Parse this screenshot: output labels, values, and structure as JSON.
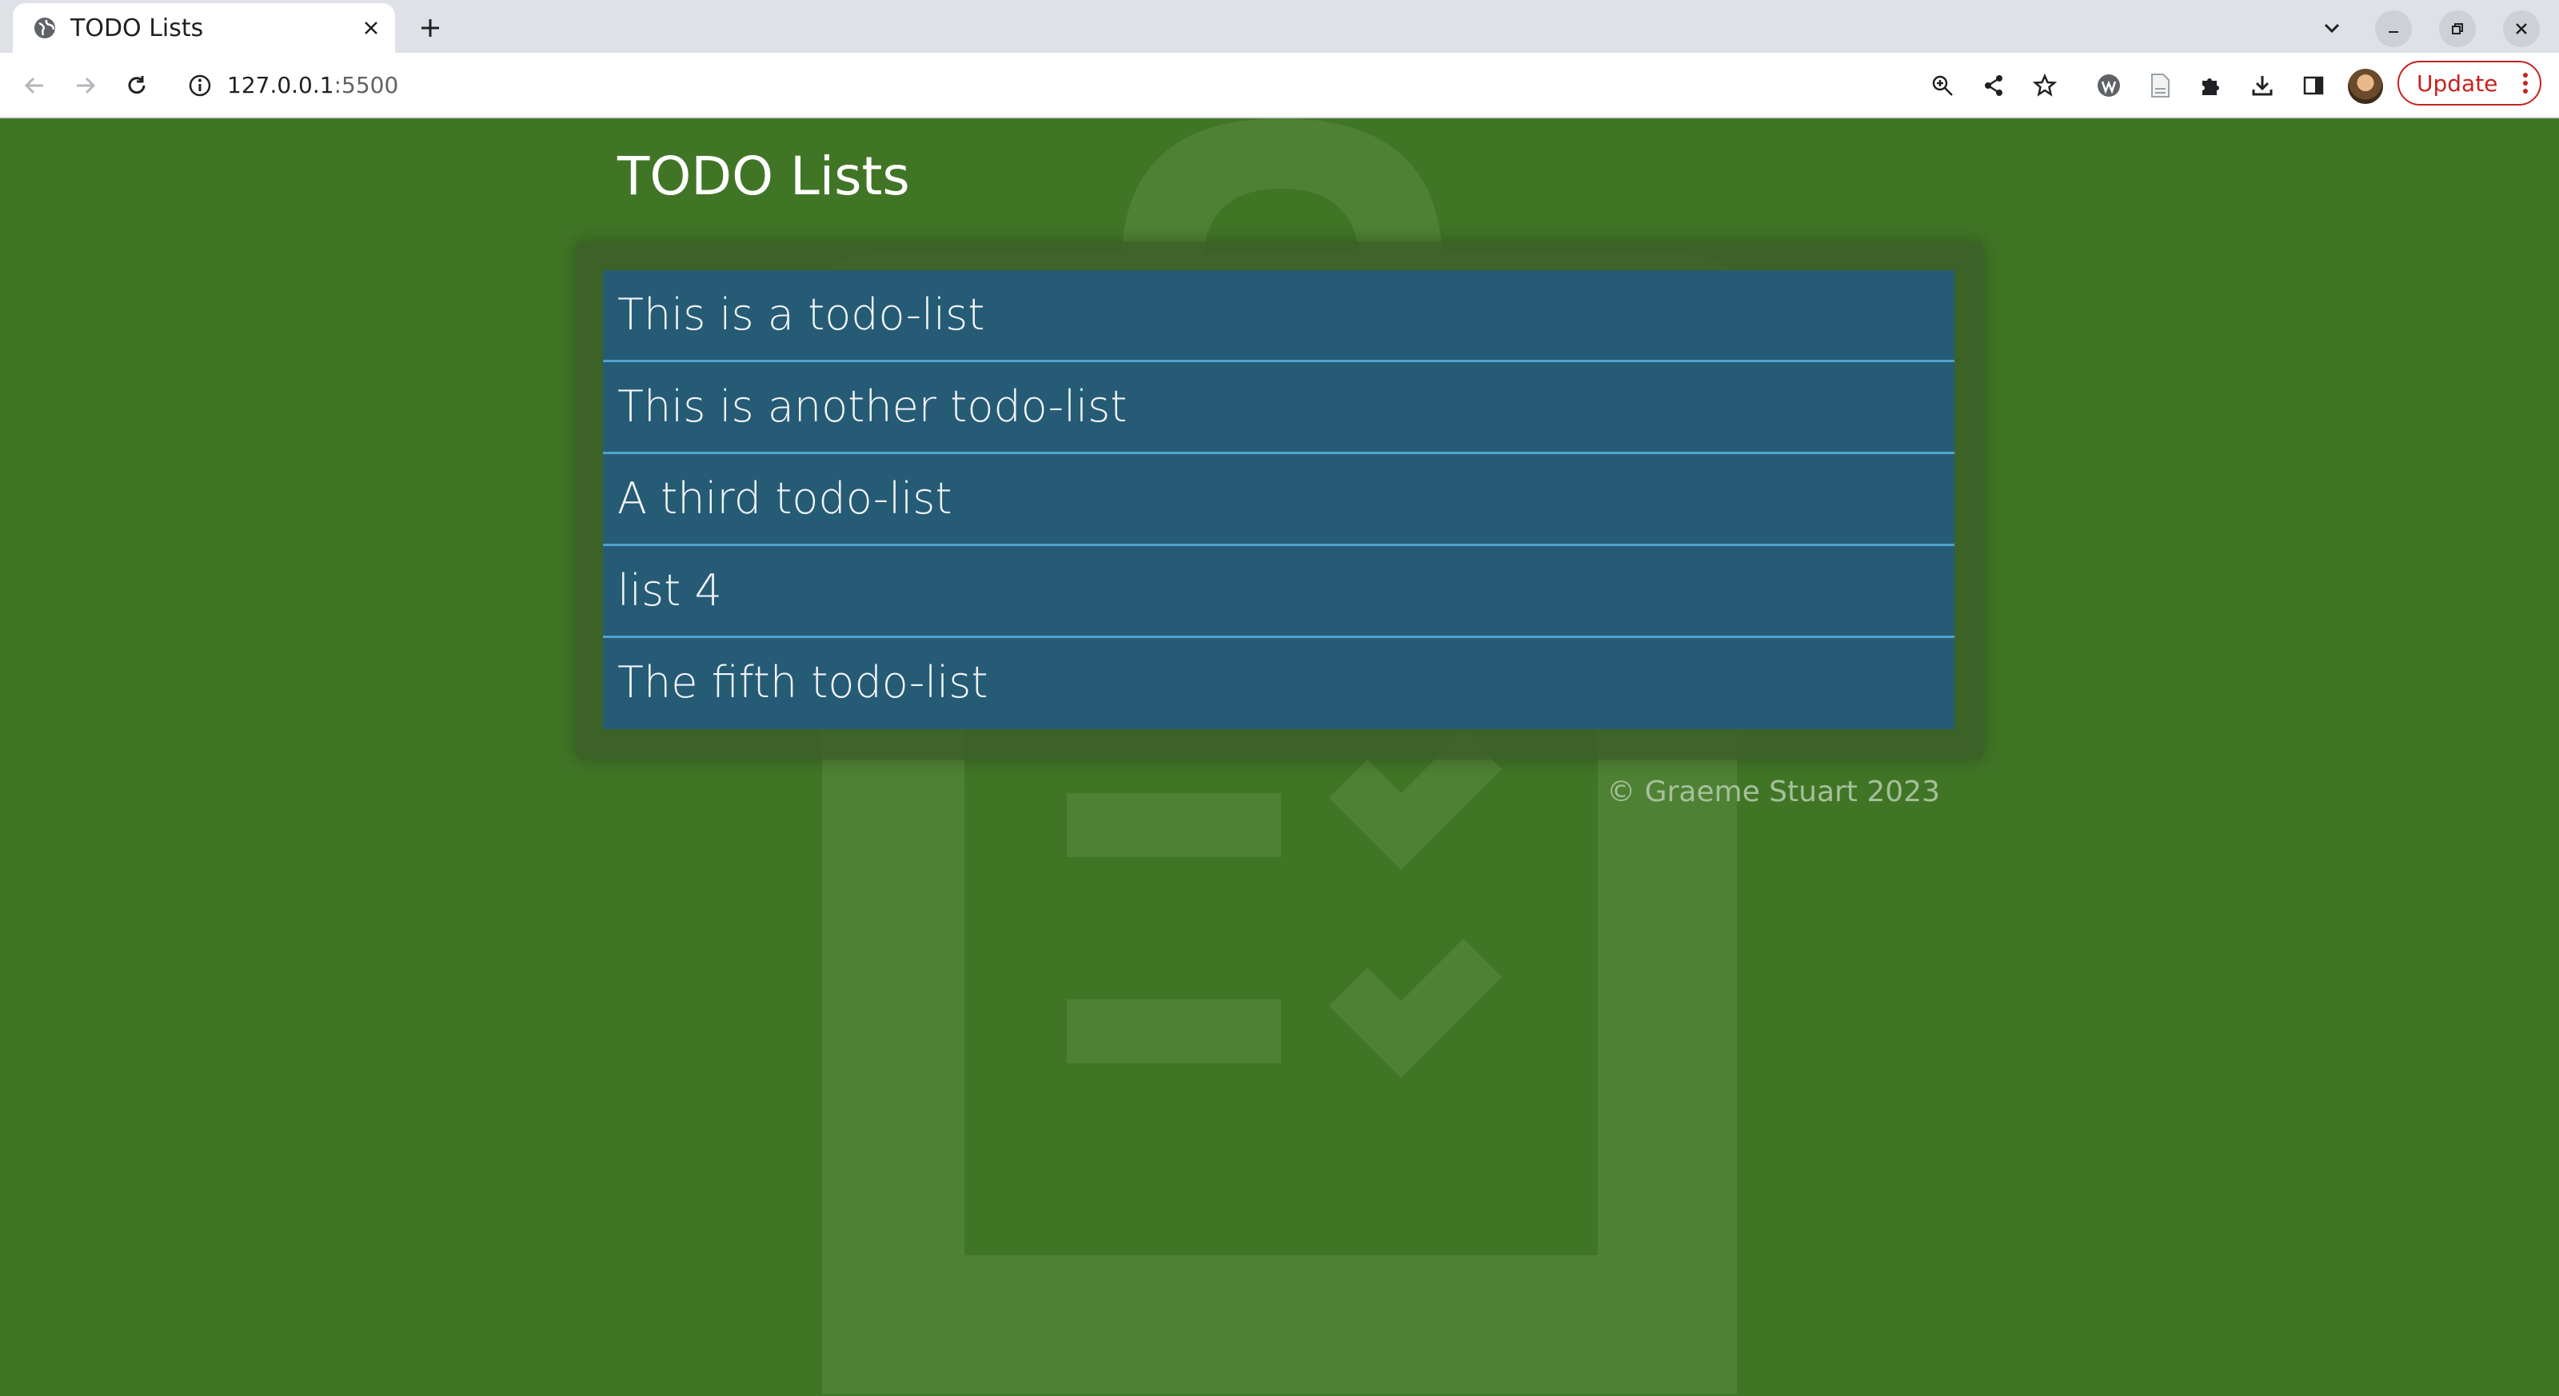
{
  "browser": {
    "tab": {
      "title": "TODO Lists"
    },
    "address": {
      "host": "127.0.0.1",
      "port": ":5500"
    },
    "update_label": "Update"
  },
  "page": {
    "title": "TODO Lists",
    "lists": [
      {
        "label": "This is a todo-list"
      },
      {
        "label": "This is another todo-list"
      },
      {
        "label": "A third todo-list"
      },
      {
        "label": "list 4"
      },
      {
        "label": "The fifth todo-list"
      }
    ],
    "footer": "© Graeme Stuart 2023"
  },
  "colors": {
    "page_background": "#417526",
    "list_item_background": "#265b76",
    "list_divider": "#4fa3cf",
    "update_accent": "#c5221f"
  }
}
